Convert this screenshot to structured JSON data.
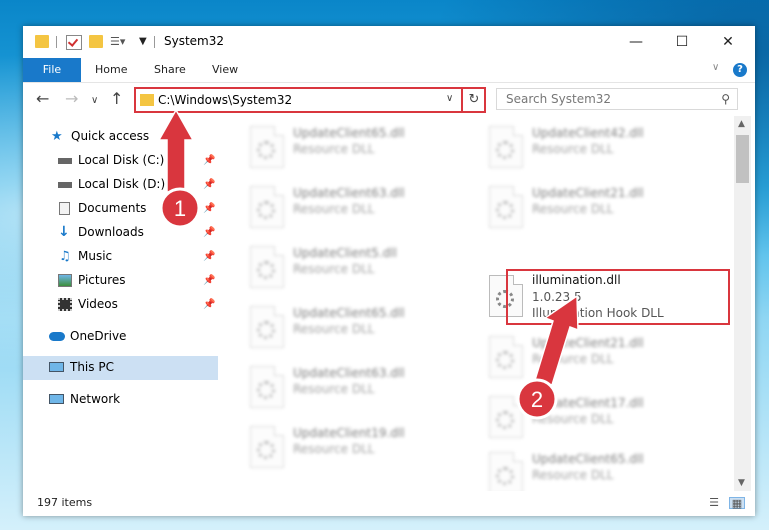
{
  "window": {
    "title": "System32",
    "minimize_glyph": "—",
    "maximize_glyph": "☐",
    "close_glyph": "✕"
  },
  "ribbon": {
    "tabs": [
      "File",
      "Home",
      "Share",
      "View"
    ],
    "help": "?"
  },
  "nav": {
    "address": "C:\\Windows\\System32",
    "search_placeholder": "Search System32"
  },
  "sidebar": {
    "items": [
      {
        "label": "Quick access",
        "icon": "star-icon"
      },
      {
        "label": "Local Disk (C:)",
        "icon": "drive-icon"
      },
      {
        "label": "Local Disk (D:)",
        "icon": "drive-icon"
      },
      {
        "label": "Documents",
        "icon": "documents-icon"
      },
      {
        "label": "Downloads",
        "icon": "downloads-icon"
      },
      {
        "label": "Music",
        "icon": "music-icon"
      },
      {
        "label": "Pictures",
        "icon": "pictures-icon"
      },
      {
        "label": "Videos",
        "icon": "videos-icon"
      },
      {
        "label": "OneDrive",
        "icon": "cloud-icon"
      },
      {
        "label": "This PC",
        "icon": "computer-icon"
      },
      {
        "label": "Network",
        "icon": "network-icon"
      }
    ]
  },
  "files": {
    "left": [
      {
        "name": "UpdateClient65.dll",
        "line2": "Resource DLL"
      },
      {
        "name": "UpdateClient63.dll",
        "line2": "Resource DLL"
      },
      {
        "name": "UpdateClient5.dll",
        "line2": "Resource DLL"
      },
      {
        "name": "UpdateClient65.dll",
        "line2": "Resource DLL"
      },
      {
        "name": "UpdateClient63.dll",
        "line2": "Resource DLL"
      },
      {
        "name": "UpdateClient19.dll",
        "line2": "Resource DLL"
      }
    ],
    "right": [
      {
        "name": "UpdateClient42.dll",
        "line2": "Resource DLL"
      },
      {
        "name": "UpdateClient21.dll",
        "line2": "Resource DLL"
      },
      {
        "name": "illumination.dll",
        "line2": "1.0.23.5",
        "line3": "Illumination Hook DLL"
      },
      {
        "name": "UpdateClient21.dll",
        "line2": "Resource DLL"
      },
      {
        "name": "UpdateClient17.dll",
        "line2": "Resource DLL"
      },
      {
        "name": "UpdateClient65.dll",
        "line2": "Resource DLL"
      }
    ]
  },
  "status": {
    "item_count": "197 items"
  },
  "annotations": {
    "step1": "1",
    "step2": "2",
    "color": "#d9363e"
  }
}
